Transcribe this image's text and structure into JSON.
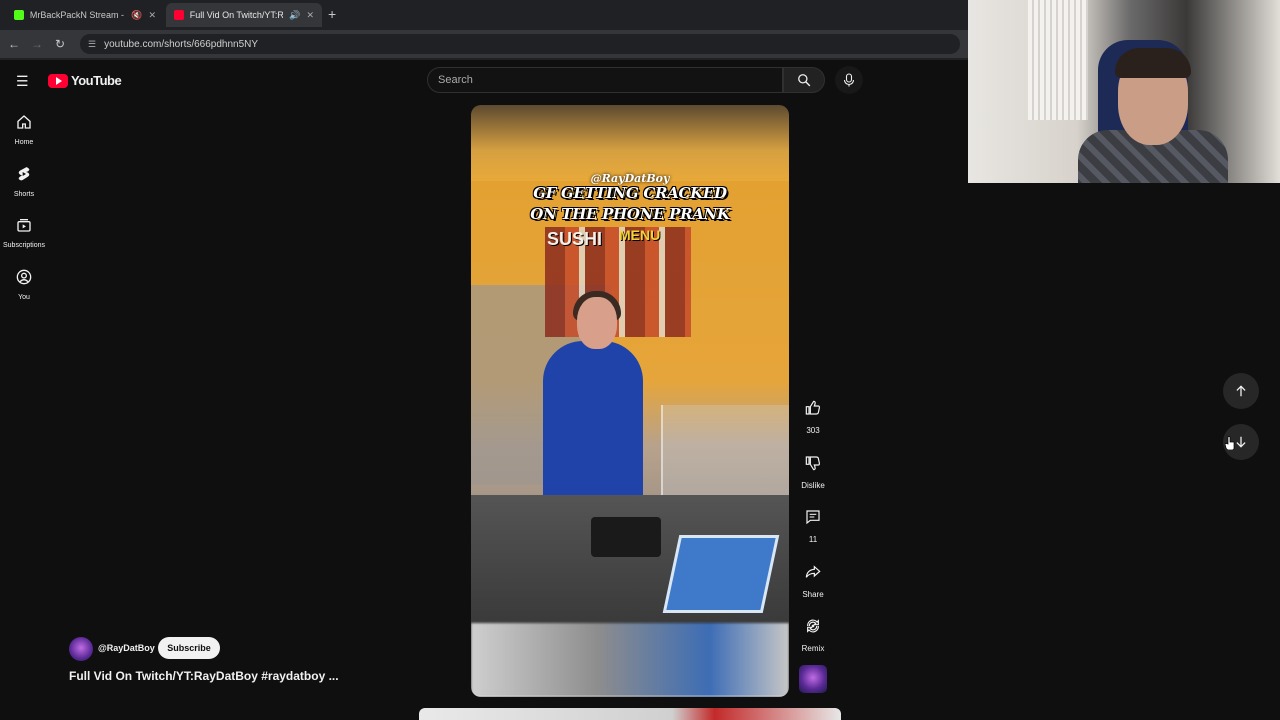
{
  "browser": {
    "tabs": [
      {
        "title": "MrBackPackN Stream - Wa"
      },
      {
        "title": "Full Vid On Twitch/YT:RayD"
      }
    ],
    "new_tab": "+",
    "url": "youtube.com/shorts/666pdhnn5NY"
  },
  "youtube": {
    "logo_text": "YouTube",
    "search_placeholder": "Search",
    "sidebar": [
      {
        "label": "Home"
      },
      {
        "label": "Shorts"
      },
      {
        "label": "Subscriptions"
      },
      {
        "label": "You"
      }
    ]
  },
  "short": {
    "overlay_handle": "@RayDatBoy",
    "overlay_caption_line1": "GF GETTING CRACKED",
    "overlay_caption_line2": "ON THE PHONE PRANK",
    "overlay_menu_text": "SUSHI",
    "overlay_menu_text2": "MENU",
    "channel": "@RayDatBoy",
    "subscribe_label": "Subscribe",
    "title": "Full Vid On Twitch/YT:RayDatBoy #raydatboy ..."
  },
  "actions": {
    "like_count": "303",
    "dislike_label": "Dislike",
    "comment_count": "11",
    "share_label": "Share",
    "remix_label": "Remix"
  },
  "colors": {
    "youtube_red": "#ff0033",
    "background": "#0f0f0f",
    "kick_green": "#53fc18"
  }
}
